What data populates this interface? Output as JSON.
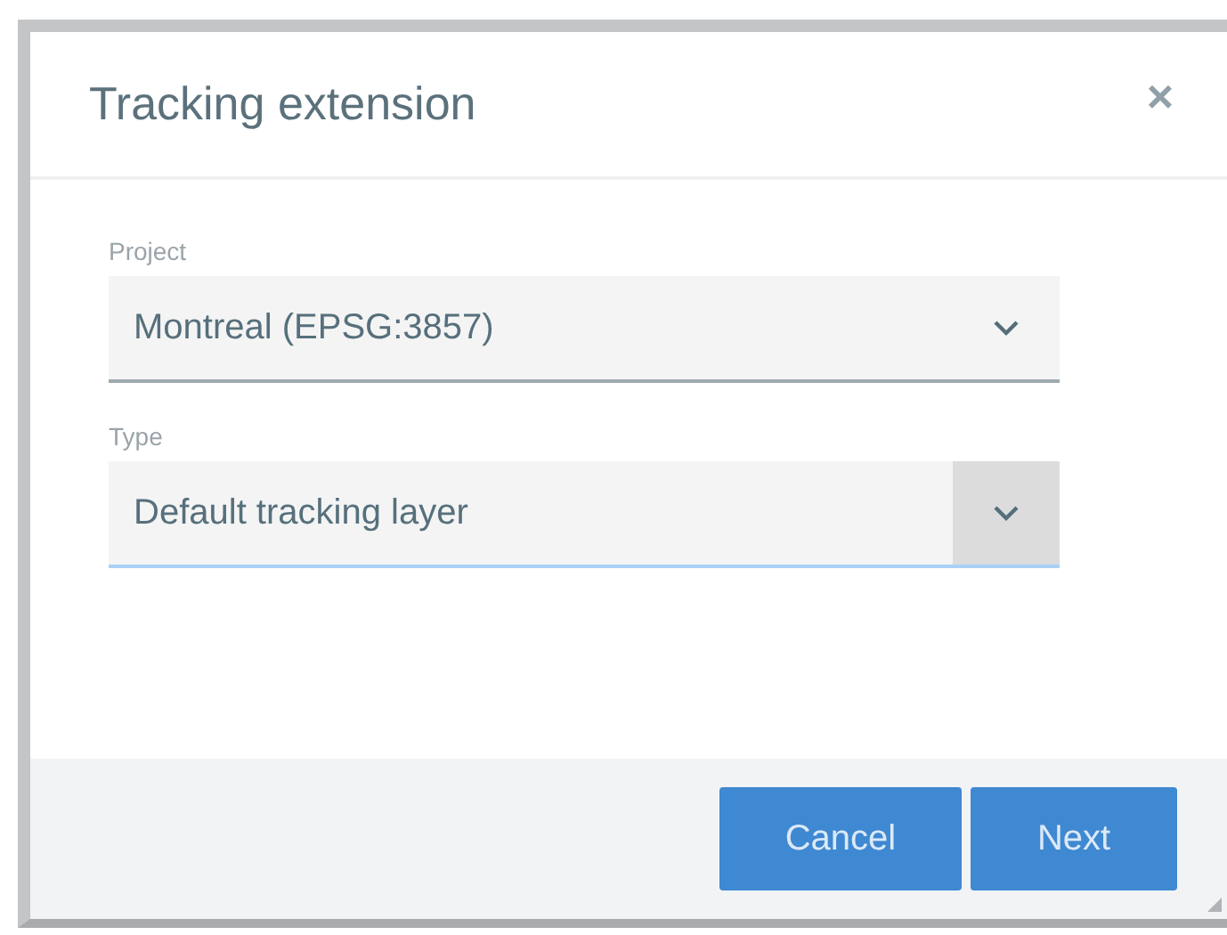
{
  "dialog": {
    "title": "Tracking extension",
    "close": "×"
  },
  "fields": [
    {
      "label": "Project",
      "value": "Montreal (EPSG:3857)",
      "focused": false
    },
    {
      "label": "Type",
      "value": "Default tracking layer",
      "focused": true
    }
  ],
  "buttons": [
    "Cancel",
    "Next"
  ]
}
